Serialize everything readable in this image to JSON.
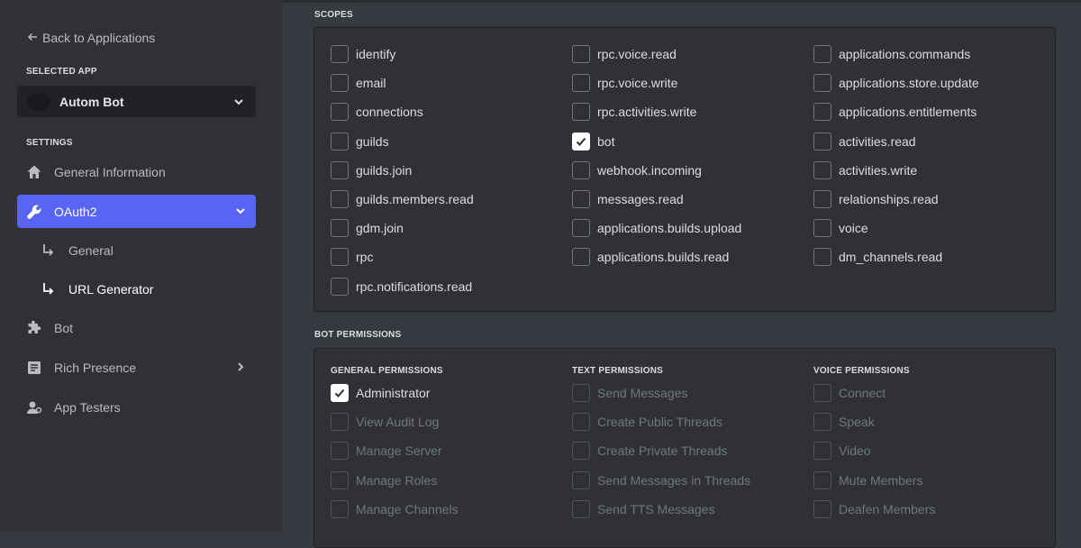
{
  "sidebar": {
    "back_label": "Back to Applications",
    "selected_app_heading": "SELECTED APP",
    "app_name": "Autom Bot",
    "settings_heading": "SETTINGS",
    "items": [
      {
        "label": "General Information",
        "icon": "home-icon"
      },
      {
        "label": "OAuth2",
        "icon": "wrench-icon"
      },
      {
        "label": "Bot",
        "icon": "puzzle-icon"
      },
      {
        "label": "Rich Presence",
        "icon": "document-icon"
      },
      {
        "label": "App Testers",
        "icon": "user-settings-icon"
      }
    ],
    "oauth_subitems": [
      {
        "label": "General"
      },
      {
        "label": "URL Generator"
      }
    ]
  },
  "scopes": {
    "heading": "SCOPES",
    "columns": [
      [
        {
          "label": "identify",
          "checked": false
        },
        {
          "label": "email",
          "checked": false
        },
        {
          "label": "connections",
          "checked": false
        },
        {
          "label": "guilds",
          "checked": false
        },
        {
          "label": "guilds.join",
          "checked": false
        },
        {
          "label": "guilds.members.read",
          "checked": false
        },
        {
          "label": "gdm.join",
          "checked": false
        },
        {
          "label": "rpc",
          "checked": false
        },
        {
          "label": "rpc.notifications.read",
          "checked": false
        }
      ],
      [
        {
          "label": "rpc.voice.read",
          "checked": false
        },
        {
          "label": "rpc.voice.write",
          "checked": false
        },
        {
          "label": "rpc.activities.write",
          "checked": false
        },
        {
          "label": "bot",
          "checked": true
        },
        {
          "label": "webhook.incoming",
          "checked": false
        },
        {
          "label": "messages.read",
          "checked": false
        },
        {
          "label": "applications.builds.upload",
          "checked": false
        },
        {
          "label": "applications.builds.read",
          "checked": false
        }
      ],
      [
        {
          "label": "applications.commands",
          "checked": false
        },
        {
          "label": "applications.store.update",
          "checked": false
        },
        {
          "label": "applications.entitlements",
          "checked": false
        },
        {
          "label": "activities.read",
          "checked": false
        },
        {
          "label": "activities.write",
          "checked": false
        },
        {
          "label": "relationships.read",
          "checked": false
        },
        {
          "label": "voice",
          "checked": false
        },
        {
          "label": "dm_channels.read",
          "checked": false
        }
      ]
    ]
  },
  "bot_permissions": {
    "heading": "BOT PERMISSIONS",
    "columns": [
      {
        "heading": "GENERAL PERMISSIONS",
        "items": [
          {
            "label": "Administrator",
            "checked": true,
            "disabled": false
          },
          {
            "label": "View Audit Log",
            "checked": false,
            "disabled": true
          },
          {
            "label": "Manage Server",
            "checked": false,
            "disabled": true
          },
          {
            "label": "Manage Roles",
            "checked": false,
            "disabled": true
          },
          {
            "label": "Manage Channels",
            "checked": false,
            "disabled": true
          }
        ]
      },
      {
        "heading": "TEXT PERMISSIONS",
        "items": [
          {
            "label": "Send Messages",
            "checked": false,
            "disabled": true
          },
          {
            "label": "Create Public Threads",
            "checked": false,
            "disabled": true
          },
          {
            "label": "Create Private Threads",
            "checked": false,
            "disabled": true
          },
          {
            "label": "Send Messages in Threads",
            "checked": false,
            "disabled": true
          },
          {
            "label": "Send TTS Messages",
            "checked": false,
            "disabled": true
          }
        ]
      },
      {
        "heading": "VOICE PERMISSIONS",
        "items": [
          {
            "label": "Connect",
            "checked": false,
            "disabled": true
          },
          {
            "label": "Speak",
            "checked": false,
            "disabled": true
          },
          {
            "label": "Video",
            "checked": false,
            "disabled": true
          },
          {
            "label": "Mute Members",
            "checked": false,
            "disabled": true
          },
          {
            "label": "Deafen Members",
            "checked": false,
            "disabled": true
          }
        ]
      }
    ]
  },
  "colors": {
    "accent": "#5865f2",
    "sidebar_bg": "#2f3136",
    "main_bg": "#36393f",
    "panel_bg": "#2f3136"
  }
}
